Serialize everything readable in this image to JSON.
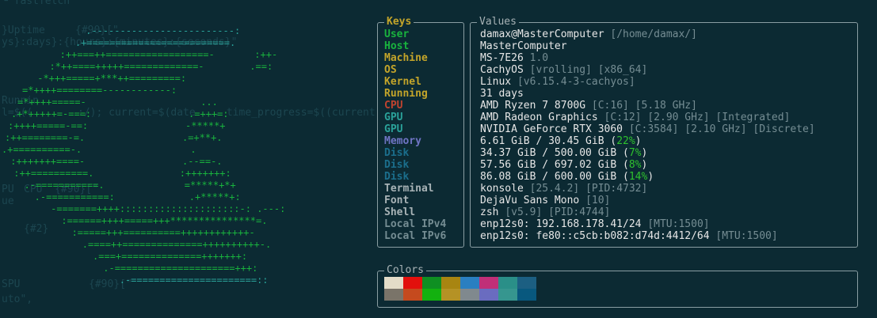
{
  "background_code": [
    "└ fastfetch",
    "}Uptime",
    "ys}:days}:{hours}:{minutes}:{seconds}\"",
    "",
    "",
    "",
    "",
    "Runnin",
    "l=$((",
    "",
    "",
    "",
    "",
    "",
    "",
    "PU",
    "ue",
    "",
    "",
    "",
    "",
    "",
    "",
    "SPU",
    "uto\","
  ],
  "background_code_overlay": {
    "line1": "{#90}[\"",
    "line2": ":/); current=$(date ... time_progress=$((current",
    "line3": "CPU  {#90}[\"",
    "line4": "{#2}",
    "line5": "{#90}[\""
  },
  "ascii_logo_lines": [
    "     .-------------------------:",
    "    .+=========================.",
    "   :++===++==================-       :++-",
    "  :*++====+++++=============-        .==:",
    " -*+++=====+***++=========:",
    "=*++++========------------:",
    "=*++++=====-                    ...",
    ".+*+++++=-===:                 .=+++=:",
    ":++++=====-==:                 -*****+",
    ":++========-=.                 .=+**+.",
    ".+==========-.                   .",
    " :+++++++====-                 .--==-.",
    " :++==========.               :+++++++:",
    "  .-===========.              =*****+*+",
    "   .-===========:             .+*****+:",
    "     -=======++++:::::::::::::::::::::-: .---:",
    "      :======++++=====+++***************=.",
    "       :=====+++==========++++++++++++-",
    "        .====++==============++++++++++-.",
    "         .===+==============+++++++:",
    "          .-=====================+++:",
    "            .-======================::"
  ],
  "keys": {
    "legend": "Keys",
    "items": [
      {
        "label": "User",
        "color": "#19b33e"
      },
      {
        "label": "Host",
        "color": "#19b33e"
      },
      {
        "label": "Machine",
        "color": "#c4a52a"
      },
      {
        "label": "OS",
        "color": "#c4a52a"
      },
      {
        "label": "Kernel",
        "color": "#c4a52a"
      },
      {
        "label": "Running",
        "color": "#c4a52a"
      },
      {
        "label": "CPU",
        "color": "#c0432f"
      },
      {
        "label": "GPU",
        "color": "#2aa29a"
      },
      {
        "label": "GPU",
        "color": "#2aa29a"
      },
      {
        "label": "Memory",
        "color": "#6f74c4"
      },
      {
        "label": "Disk",
        "color": "#1b6e8c"
      },
      {
        "label": "Disk",
        "color": "#1b6e8c"
      },
      {
        "label": "Disk",
        "color": "#1b6e8c"
      },
      {
        "label": "Terminal",
        "color": "#a8b3b6"
      },
      {
        "label": "Font",
        "color": "#a8b3b6"
      },
      {
        "label": "Shell",
        "color": "#a8b3b6"
      },
      {
        "label": "Local IPv4",
        "color": "#758d93"
      },
      {
        "label": "Local IPv6",
        "color": "#758d93"
      }
    ]
  },
  "values": {
    "legend": "Values",
    "user_main": "damax@MasterComputer",
    "user_dim": "[/home/damax/]",
    "host": "MasterComputer",
    "machine_main": "MS-7E26",
    "machine_dim": "1.0",
    "os_main": "CachyOS",
    "os_dim": "[vrolling] [x86_64]",
    "kernel_main": "Linux",
    "kernel_dim": "[v6.15.4-3-cachyos]",
    "running": "31 days",
    "cpu_main": "AMD Ryzen 7 8700G",
    "cpu_dim": "[C:16] [5.18 GHz]",
    "gpu1_main": "AMD Radeon Graphics",
    "gpu1_dim": "[C:12] [2.90 GHz] [Integrated]",
    "gpu2_main": "NVIDIA GeForce RTX 3060",
    "gpu2_dim": "[C:3584] [2.10 GHz] [Discrete]",
    "memory_main": "6.61 GiB / 30.45 GiB (",
    "memory_pct": "22%",
    "disk1_main": "34.37 GiB / 500.00 GiB (",
    "disk1_pct": "7%",
    "disk2_main": "57.56 GiB / 697.02 GiB (",
    "disk2_pct": "8%",
    "disk3_main": "86.08 GiB / 600.00 GiB (",
    "disk3_pct": "14%",
    "close_paren": ")",
    "terminal_main": "konsole",
    "terminal_dim": "[25.4.2] [PID:4732]",
    "font_main": "DejaVu Sans Mono",
    "font_dim": "[10]",
    "shell_main": "zsh",
    "shell_dim": "[v5.9] [PID:4744]",
    "ipv4_main": "enp12s0: 192.168.178.41/24",
    "ipv4_dim": "[MTU:1500]",
    "ipv6_main": "enp12s0: fe80::c5cb:b082:d74d:4412/64",
    "ipv6_dim": "[MTU:1500]"
  },
  "colors": {
    "legend": "Colors",
    "swatches": [
      "#e3dcc8",
      "#e2100d",
      "#0f8f22",
      "#a88511",
      "#2a7fc1",
      "#c02f78",
      "#2a8f88",
      "#1c5f82",
      "#7a7469",
      "#c54a1e",
      "#13b10f",
      "#b59225",
      "#80898e",
      "#6a6cc0",
      "#36968f",
      "#08587e"
    ]
  }
}
